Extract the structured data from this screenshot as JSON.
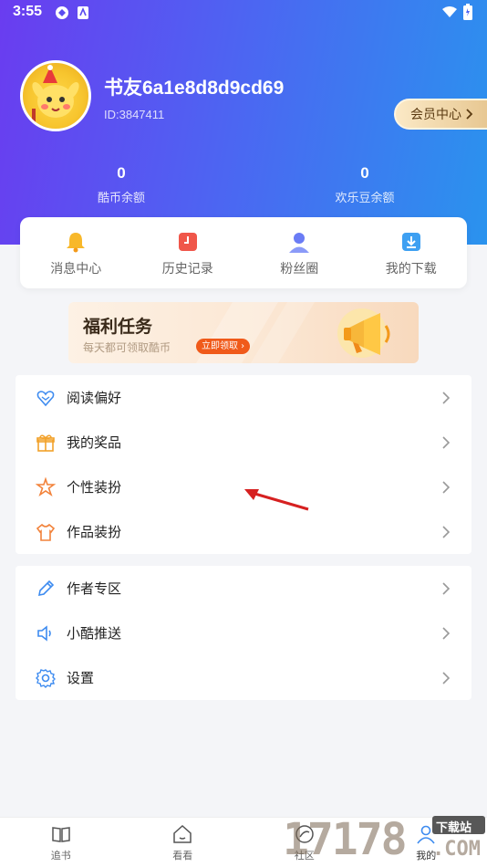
{
  "status_bar": {
    "time": "3:55"
  },
  "profile": {
    "username": "书友6a1e8d8d9cd69",
    "user_id": "ID:3847411",
    "vip_button": "会员中心"
  },
  "stats": [
    {
      "value": "0",
      "label": "酷币余额"
    },
    {
      "value": "0",
      "label": "欢乐豆余额"
    }
  ],
  "quick_actions": [
    {
      "label": "消息中心",
      "icon": "bell-icon"
    },
    {
      "label": "历史记录",
      "icon": "history-icon"
    },
    {
      "label": "粉丝圈",
      "icon": "fans-icon"
    },
    {
      "label": "我的下载",
      "icon": "download-icon"
    }
  ],
  "banner": {
    "title": "福利任务",
    "subtitle": "每天都可领取酷币",
    "cta": "立即领取"
  },
  "menu_group_1": [
    {
      "label": "阅读偏好",
      "icon": "heart-icon"
    },
    {
      "label": "我的奖品",
      "icon": "gift-icon"
    },
    {
      "label": "个性装扮",
      "icon": "star-icon"
    },
    {
      "label": "作品装扮",
      "icon": "shirt-icon"
    }
  ],
  "menu_group_2": [
    {
      "label": "作者专区",
      "icon": "pen-icon"
    },
    {
      "label": "小酷推送",
      "icon": "speaker-icon"
    },
    {
      "label": "设置",
      "icon": "gear-icon"
    }
  ],
  "tabbar": [
    {
      "label": "追书",
      "icon": "book-icon"
    },
    {
      "label": "看看",
      "icon": "home-icon"
    },
    {
      "label": "社区",
      "icon": "community-icon"
    },
    {
      "label": "我的",
      "icon": "user-icon"
    }
  ],
  "watermark": {
    "text": "17178",
    "sub": "下载站",
    "tld": ".COM"
  },
  "colors": {
    "header_start": "#6a3cf0",
    "header_end": "#2a93ee",
    "accent_orange": "#f05a1a",
    "menu_icon_blue": "#3d8bf0",
    "menu_icon_orange": "#f2823a"
  }
}
